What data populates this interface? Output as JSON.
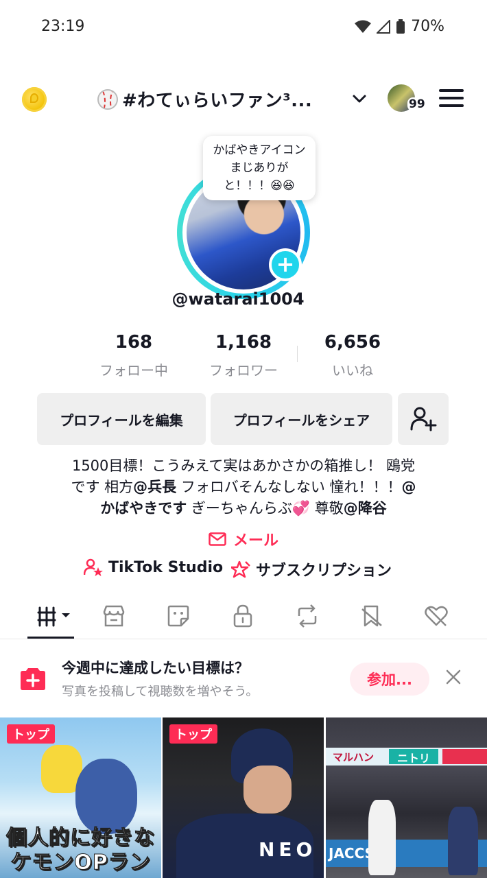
{
  "status": {
    "time": "23:19",
    "battery": "70%"
  },
  "header": {
    "title": "#わてぃらいファン³...",
    "badge_count": "99"
  },
  "profile": {
    "bubble_text": "かばやきアイコンまじありがと！！！😆😆",
    "username": "@watarai1004"
  },
  "stats": [
    {
      "value": "168",
      "label": "フォロー中"
    },
    {
      "value": "1,168",
      "label": "フォロワー"
    },
    {
      "value": "6,656",
      "label": "いいね"
    }
  ],
  "buttons": {
    "edit": "プロフィールを編集",
    "share": "プロフィールをシェア"
  },
  "bio": {
    "line1": "1500目標！こうみえて実はあかさかの箱推し！ 鴎党",
    "line2a": "です 相方",
    "line2b": "@兵長",
    "line2c": " フォロバそんなしない 憧れ！！！",
    "line2d": "@",
    "line3a": "かばやきです",
    "line3b": " ぎーちゃんらぶ💞 尊敬",
    "line3c": "@降谷"
  },
  "mail_label": "メール",
  "links": {
    "studio": "TikTok Studio",
    "subscription": "サブスクリプション"
  },
  "banner": {
    "title": "今週中に達成したい目標は？",
    "subtitle": "写真を投稿して視聴数を増やそう。",
    "join": "参加..."
  },
  "videos": [
    {
      "tag": "トップ",
      "caption_line1": "個人的に好きな",
      "caption_line2": "ケモンOPランキン"
    },
    {
      "tag": "トップ",
      "jersey": "NEO"
    },
    {
      "board1": "マルハン",
      "board2": "ニトリ",
      "board3": "JACCS"
    }
  ],
  "colors": {
    "accent": "#fe2c55",
    "ring": "#20d5ec"
  }
}
